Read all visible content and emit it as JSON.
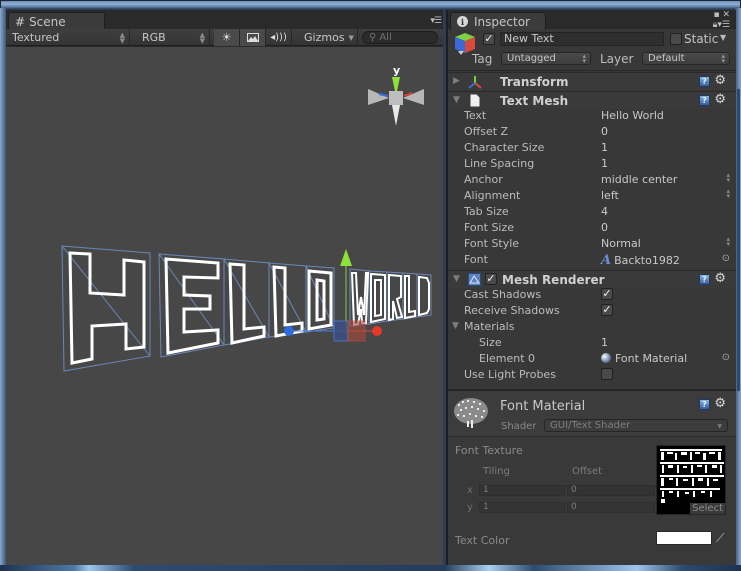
{
  "scene": {
    "tab_label": "Scene",
    "toolbar": {
      "render_mode": "Textured",
      "color_mode": "RGB",
      "gizmos_label": "Gizmos",
      "search_placeholder": "All"
    },
    "gizmo_axis_label": "y",
    "scene_text": "HELLO WORLD"
  },
  "inspector": {
    "tab_label": "Inspector",
    "gameobject": {
      "active": true,
      "name": "New Text",
      "static": false,
      "static_label": "Static",
      "tag_label": "Tag",
      "tag_value": "Untagged",
      "layer_label": "Layer",
      "layer_value": "Default"
    },
    "components": {
      "transform": {
        "title": "Transform",
        "expanded": false
      },
      "text_mesh": {
        "title": "Text Mesh",
        "expanded": true,
        "props": [
          {
            "label": "Text",
            "value": "Hello World"
          },
          {
            "label": "Offset Z",
            "value": "0"
          },
          {
            "label": "Character Size",
            "value": "1"
          },
          {
            "label": "Line Spacing",
            "value": "1"
          },
          {
            "label": "Anchor",
            "value": "middle center"
          },
          {
            "label": "Alignment",
            "value": "left"
          },
          {
            "label": "Tab Size",
            "value": "4"
          },
          {
            "label": "Font Size",
            "value": "0"
          },
          {
            "label": "Font Style",
            "value": "Normal"
          },
          {
            "label": "Font",
            "value": "Backto1982"
          }
        ]
      },
      "mesh_renderer": {
        "title": "Mesh Renderer",
        "enabled": true,
        "cast_shadows_label": "Cast Shadows",
        "cast_shadows": true,
        "receive_shadows_label": "Receive Shadows",
        "receive_shadows": true,
        "materials_label": "Materials",
        "size_label": "Size",
        "size_value": "1",
        "element0_label": "Element 0",
        "element0_value": "Font Material",
        "light_probes_label": "Use Light Probes",
        "light_probes": false
      }
    },
    "material": {
      "name": "Font Material",
      "shader_label": "Shader",
      "shader_value": "GUI/Text Shader",
      "font_texture_label": "Font Texture",
      "tiling_label": "Tiling",
      "offset_label": "Offset",
      "x_label": "x",
      "y_label": "y",
      "tiling_x": "1",
      "tiling_y": "1",
      "offset_x": "0",
      "offset_y": "0",
      "select_label": "Select",
      "text_color_label": "Text Color",
      "text_color": "#ffffff"
    }
  }
}
